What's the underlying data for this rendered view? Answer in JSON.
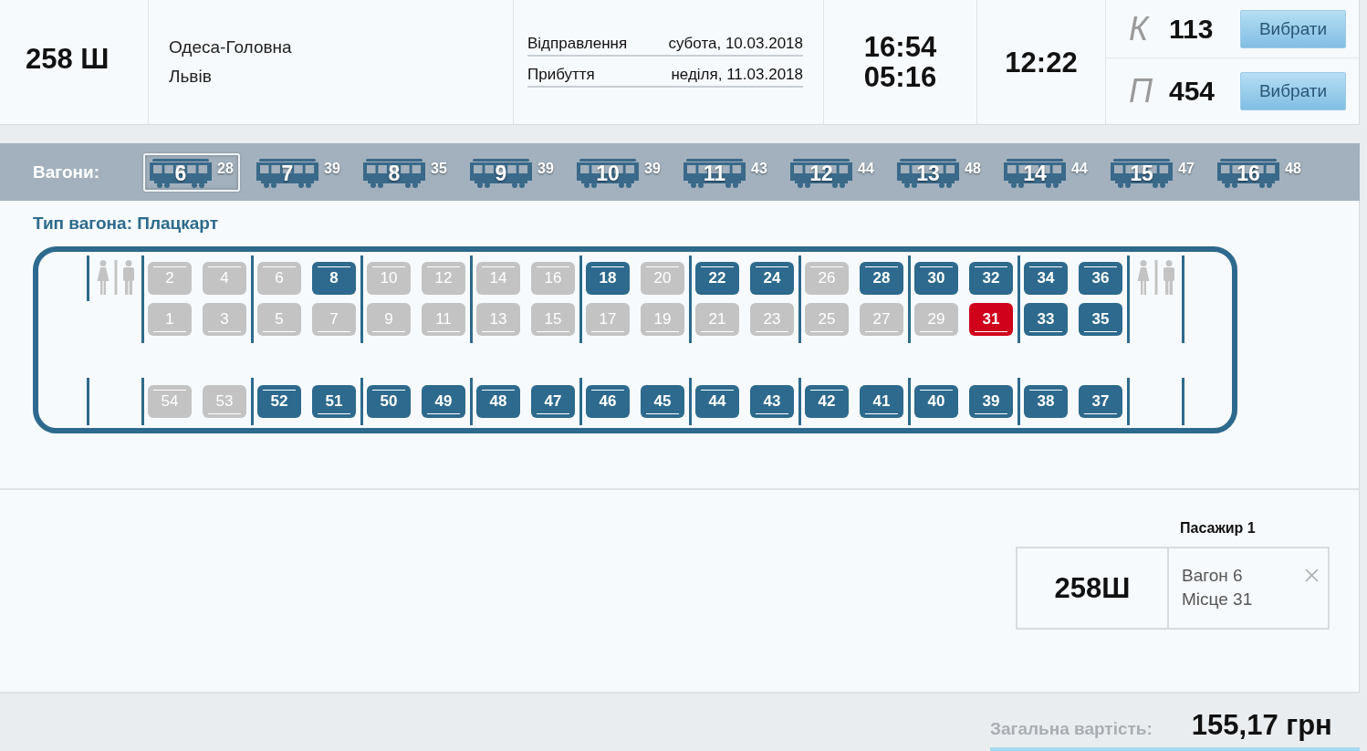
{
  "train": {
    "number": "258 Ш",
    "route": {
      "from": "Одеса-Головна",
      "to": "Львів"
    },
    "schedule": [
      {
        "label": "Відправлення",
        "date": "субота, 10.03.2018"
      },
      {
        "label": "Прибуття",
        "date": "неділя, 11.03.2018"
      }
    ],
    "times": [
      "16:54",
      "05:16"
    ],
    "duration": "12:22",
    "classes": [
      {
        "code": "К",
        "seats": "113",
        "button": "Вибрати"
      },
      {
        "code": "П",
        "seats": "454",
        "button": "Вибрати"
      }
    ]
  },
  "wagons": {
    "label": "Вагони:",
    "items": [
      {
        "number": "6",
        "free": "28",
        "selected": true
      },
      {
        "number": "7",
        "free": "39",
        "selected": false
      },
      {
        "number": "8",
        "free": "35",
        "selected": false
      },
      {
        "number": "9",
        "free": "39",
        "selected": false
      },
      {
        "number": "10",
        "free": "39",
        "selected": false
      },
      {
        "number": "11",
        "free": "43",
        "selected": false
      },
      {
        "number": "12",
        "free": "44",
        "selected": false
      },
      {
        "number": "13",
        "free": "48",
        "selected": false
      },
      {
        "number": "14",
        "free": "44",
        "selected": false
      },
      {
        "number": "15",
        "free": "47",
        "selected": false
      },
      {
        "number": "16",
        "free": "48",
        "selected": false
      }
    ]
  },
  "car_type": "Тип вагона: Плацкарт",
  "seat_map": {
    "compartments": [
      {
        "upper": [
          {
            "number": "2",
            "kind": "upper",
            "available": false,
            "selected": false
          },
          {
            "number": "4",
            "kind": "upper",
            "available": false,
            "selected": false
          }
        ],
        "lower": [
          {
            "number": "1",
            "kind": "lower",
            "available": false,
            "selected": false
          },
          {
            "number": "3",
            "kind": "lower",
            "available": false,
            "selected": false
          }
        ],
        "side": [
          {
            "number": "54",
            "kind": "upper",
            "available": false,
            "selected": false
          },
          {
            "number": "53",
            "kind": "lower",
            "available": false,
            "selected": false
          }
        ]
      },
      {
        "upper": [
          {
            "number": "6",
            "kind": "upper",
            "available": false,
            "selected": false
          },
          {
            "number": "8",
            "kind": "upper",
            "available": true,
            "selected": false
          }
        ],
        "lower": [
          {
            "number": "5",
            "kind": "lower",
            "available": false,
            "selected": false
          },
          {
            "number": "7",
            "kind": "lower",
            "available": false,
            "selected": false
          }
        ],
        "side": [
          {
            "number": "52",
            "kind": "upper",
            "available": true,
            "selected": false
          },
          {
            "number": "51",
            "kind": "lower",
            "available": true,
            "selected": false
          }
        ]
      },
      {
        "upper": [
          {
            "number": "10",
            "kind": "upper",
            "available": false,
            "selected": false
          },
          {
            "number": "12",
            "kind": "upper",
            "available": false,
            "selected": false
          }
        ],
        "lower": [
          {
            "number": "9",
            "kind": "lower",
            "available": false,
            "selected": false
          },
          {
            "number": "11",
            "kind": "lower",
            "available": false,
            "selected": false
          }
        ],
        "side": [
          {
            "number": "50",
            "kind": "upper",
            "available": true,
            "selected": false
          },
          {
            "number": "49",
            "kind": "lower",
            "available": true,
            "selected": false
          }
        ]
      },
      {
        "upper": [
          {
            "number": "14",
            "kind": "upper",
            "available": false,
            "selected": false
          },
          {
            "number": "16",
            "kind": "upper",
            "available": false,
            "selected": false
          }
        ],
        "lower": [
          {
            "number": "13",
            "kind": "lower",
            "available": false,
            "selected": false
          },
          {
            "number": "15",
            "kind": "lower",
            "available": false,
            "selected": false
          }
        ],
        "side": [
          {
            "number": "48",
            "kind": "upper",
            "available": true,
            "selected": false
          },
          {
            "number": "47",
            "kind": "lower",
            "available": true,
            "selected": false
          }
        ]
      },
      {
        "upper": [
          {
            "number": "18",
            "kind": "upper",
            "available": true,
            "selected": false
          },
          {
            "number": "20",
            "kind": "upper",
            "available": false,
            "selected": false
          }
        ],
        "lower": [
          {
            "number": "17",
            "kind": "lower",
            "available": false,
            "selected": false
          },
          {
            "number": "19",
            "kind": "lower",
            "available": false,
            "selected": false
          }
        ],
        "side": [
          {
            "number": "46",
            "kind": "upper",
            "available": true,
            "selected": false
          },
          {
            "number": "45",
            "kind": "lower",
            "available": true,
            "selected": false
          }
        ]
      },
      {
        "upper": [
          {
            "number": "22",
            "kind": "upper",
            "available": true,
            "selected": false
          },
          {
            "number": "24",
            "kind": "upper",
            "available": true,
            "selected": false
          }
        ],
        "lower": [
          {
            "number": "21",
            "kind": "lower",
            "available": false,
            "selected": false
          },
          {
            "number": "23",
            "kind": "lower",
            "available": false,
            "selected": false
          }
        ],
        "side": [
          {
            "number": "44",
            "kind": "upper",
            "available": true,
            "selected": false
          },
          {
            "number": "43",
            "kind": "lower",
            "available": true,
            "selected": false
          }
        ]
      },
      {
        "upper": [
          {
            "number": "26",
            "kind": "upper",
            "available": false,
            "selected": false
          },
          {
            "number": "28",
            "kind": "upper",
            "available": true,
            "selected": false
          }
        ],
        "lower": [
          {
            "number": "25",
            "kind": "lower",
            "available": false,
            "selected": false
          },
          {
            "number": "27",
            "kind": "lower",
            "available": false,
            "selected": false
          }
        ],
        "side": [
          {
            "number": "42",
            "kind": "upper",
            "available": true,
            "selected": false
          },
          {
            "number": "41",
            "kind": "lower",
            "available": true,
            "selected": false
          }
        ]
      },
      {
        "upper": [
          {
            "number": "30",
            "kind": "upper",
            "available": true,
            "selected": false
          },
          {
            "number": "32",
            "kind": "upper",
            "available": true,
            "selected": false
          }
        ],
        "lower": [
          {
            "number": "29",
            "kind": "lower",
            "available": false,
            "selected": false
          },
          {
            "number": "31",
            "kind": "lower",
            "available": true,
            "selected": true
          }
        ],
        "side": [
          {
            "number": "40",
            "kind": "upper",
            "available": true,
            "selected": false
          },
          {
            "number": "39",
            "kind": "lower",
            "available": true,
            "selected": false
          }
        ]
      },
      {
        "upper": [
          {
            "number": "34",
            "kind": "upper",
            "available": true,
            "selected": false
          },
          {
            "number": "36",
            "kind": "upper",
            "available": true,
            "selected": false
          }
        ],
        "lower": [
          {
            "number": "33",
            "kind": "lower",
            "available": true,
            "selected": false
          },
          {
            "number": "35",
            "kind": "lower",
            "available": true,
            "selected": false
          }
        ],
        "side": [
          {
            "number": "38",
            "kind": "upper",
            "available": true,
            "selected": false
          },
          {
            "number": "37",
            "kind": "lower",
            "available": true,
            "selected": false
          }
        ]
      }
    ]
  },
  "passenger": {
    "title": "Пасажир 1",
    "train": "258Ш",
    "wagon": "Вагон 6",
    "seat": "Місце 31"
  },
  "total": {
    "label": "Загальна вартість:",
    "amount": "155,17 грн"
  }
}
